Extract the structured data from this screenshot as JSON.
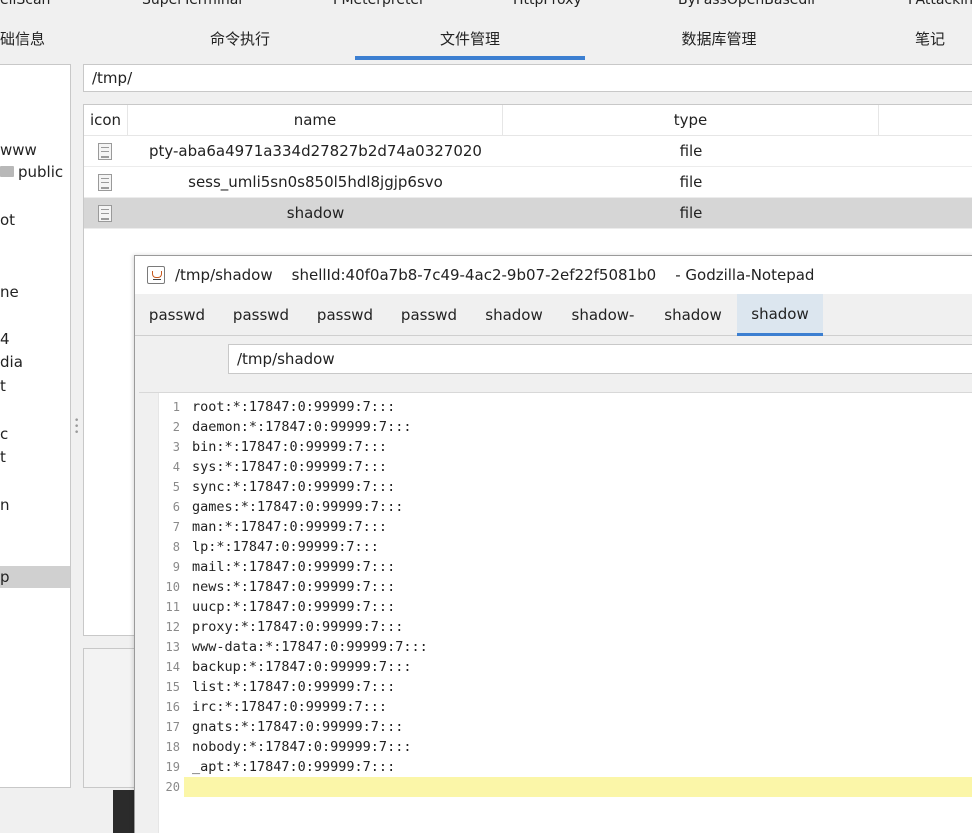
{
  "plugin_tabs": [
    "eliScan",
    "SuperTerminal",
    "PMeterpreter",
    "HttpProxy",
    "ByPassOpenBasedir",
    "PAttackin"
  ],
  "main_tabs": [
    {
      "label": "础信息"
    },
    {
      "label": "命令执行"
    },
    {
      "label": "文件管理",
      "active": true
    },
    {
      "label": "数据库管理"
    },
    {
      "label": "笔记"
    }
  ],
  "tree": {
    "items": [
      {
        "label": "www"
      },
      {
        "label": "public",
        "folder": true
      },
      {
        "label": "ot"
      },
      {
        "label": "ne"
      },
      {
        "label": "4"
      },
      {
        "label": "dia"
      },
      {
        "label": "t"
      },
      {
        "label": "c"
      },
      {
        "label": "t"
      },
      {
        "label": "n"
      },
      {
        "label": "p",
        "selected": true
      }
    ]
  },
  "file_manager": {
    "path": "/tmp/",
    "columns": [
      "icon",
      "name",
      "type"
    ],
    "rows": [
      {
        "icon": "file-icon",
        "name": "pty-aba6a4971a334d27827b2d74a0327020",
        "type": "file"
      },
      {
        "icon": "file-icon",
        "name": "sess_umli5sn0s850l5hdl8jgjp6svo",
        "type": "file"
      },
      {
        "icon": "file-icon",
        "name": "shadow",
        "type": "file",
        "selected": true
      }
    ]
  },
  "notepad": {
    "title": "/tmp/shadow    shellId:40f0a7b8-7c49-4ac2-9b07-2ef22f5081b0    - Godzilla-Notepad",
    "tabs": [
      {
        "label": "passwd"
      },
      {
        "label": "passwd"
      },
      {
        "label": "passwd"
      },
      {
        "label": "passwd"
      },
      {
        "label": "shadow"
      },
      {
        "label": "shadow-"
      },
      {
        "label": "shadow"
      },
      {
        "label": "shadow",
        "active": true
      }
    ],
    "path": "/tmp/shadow",
    "current_line": 20,
    "lines": [
      "root:*:17847:0:99999:7:::",
      "daemon:*:17847:0:99999:7:::",
      "bin:*:17847:0:99999:7:::",
      "sys:*:17847:0:99999:7:::",
      "sync:*:17847:0:99999:7:::",
      "games:*:17847:0:99999:7:::",
      "man:*:17847:0:99999:7:::",
      "lp:*:17847:0:99999:7:::",
      "mail:*:17847:0:99999:7:::",
      "news:*:17847:0:99999:7:::",
      "uucp:*:17847:0:99999:7:::",
      "proxy:*:17847:0:99999:7:::",
      "www-data:*:17847:0:99999:7:::",
      "backup:*:17847:0:99999:7:::",
      "list:*:17847:0:99999:7:::",
      "irc:*:17847:0:99999:7:::",
      "gnats:*:17847:0:99999:7:::",
      "nobody:*:17847:0:99999:7:::",
      "_apt:*:17847:0:99999:7:::",
      ""
    ]
  },
  "colors": {
    "accent": "#3c7fd1",
    "current_line_highlight": "#fbf6a8",
    "selected_row": "#d6d6d6"
  }
}
